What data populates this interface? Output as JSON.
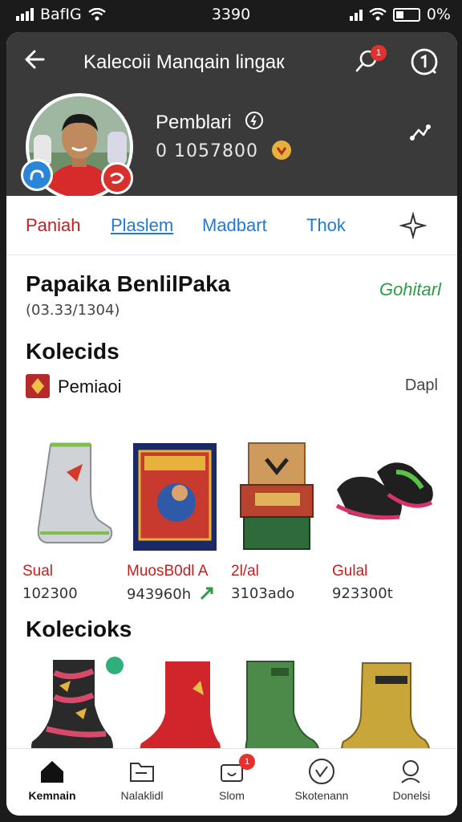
{
  "status_bar": {
    "carrier": "BafIG",
    "time": "3390",
    "battery": "0%"
  },
  "header": {
    "title": "Kalecoii Manqain lingaк",
    "notification_count": "1",
    "profile_name": "Pemblari",
    "profile_coins": "0 1057800"
  },
  "tabs": [
    {
      "label": "Paniah",
      "color": "#c42020"
    },
    {
      "label": "Plaslem",
      "color": "#1f7ad1"
    },
    {
      "label": "Madbart",
      "color": "#1f7ad1"
    },
    {
      "label": "Thok",
      "color": "#1f7ad1"
    }
  ],
  "section1": {
    "title": "Papaika BenlilPaka",
    "subtitle": "(03.33/1304)",
    "link": "Gohitarl"
  },
  "section2": {
    "title": "Kolecids",
    "category_label": "Pemiaoi",
    "category_link": "Dapl",
    "products": [
      {
        "name": "Sual",
        "price": "102300"
      },
      {
        "name": "MuosB0dl A",
        "price": "943960h"
      },
      {
        "name": "2l/al",
        "price": "3103ado"
      },
      {
        "name": "Gulal",
        "price": "923300t"
      }
    ]
  },
  "section3": {
    "title": "Kolecioks"
  },
  "bottom_nav": {
    "items": [
      {
        "label": "Kemnain",
        "icon": "home-icon",
        "active": true
      },
      {
        "label": "Nalaklidl",
        "icon": "folder-icon",
        "active": false
      },
      {
        "label": "Slom",
        "icon": "store-icon",
        "active": false,
        "badge": "1"
      },
      {
        "label": "Skotenann",
        "icon": "heart-icon",
        "active": false
      },
      {
        "label": "Donelsi",
        "icon": "profile-icon",
        "active": false
      }
    ]
  },
  "colors": {
    "header_bg": "#3a3a3a",
    "accent_red": "#c42020",
    "accent_blue": "#1f7ad1",
    "accent_green": "#2d9d45"
  }
}
